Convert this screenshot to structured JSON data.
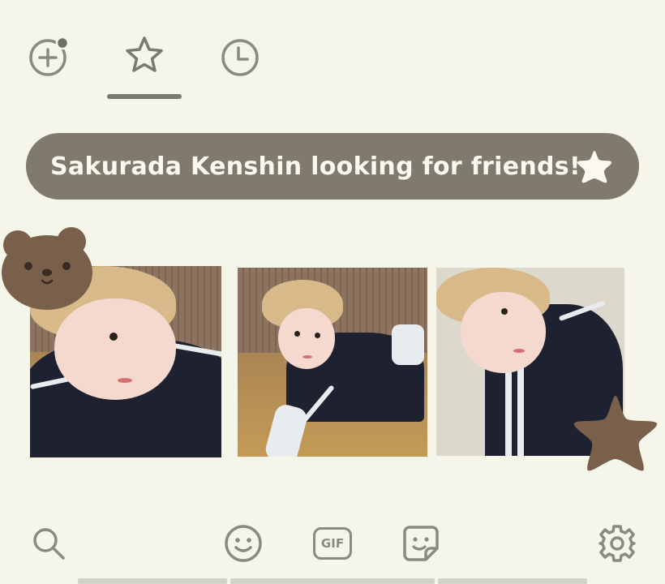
{
  "tabs": [
    {
      "name": "add-emoji",
      "icon": "add-circle-icon",
      "badge": true
    },
    {
      "name": "favorites",
      "icon": "star-outline-icon",
      "selected": true
    },
    {
      "name": "recent",
      "icon": "clock-icon"
    }
  ],
  "banner": {
    "text": "Sakurada Kenshin looking for friends!",
    "star_icon": "star-icon"
  },
  "stickers": [
    {
      "name": "photo-1"
    },
    {
      "name": "photo-2"
    },
    {
      "name": "photo-3"
    }
  ],
  "decorations": {
    "bear": "bear-face-icon",
    "star": "brown-star-icon"
  },
  "toolbar": {
    "search_icon": "search-icon",
    "emoji_icon": "smiley-icon",
    "gif_label": "GIF",
    "sticker_icon": "sticker-icon",
    "settings_icon": "gear-icon"
  },
  "colors": {
    "background": "#f5f5ea",
    "banner": "#7f7a6d",
    "icon": "#8a8a80",
    "accent_brown": "#7a5f4a"
  }
}
